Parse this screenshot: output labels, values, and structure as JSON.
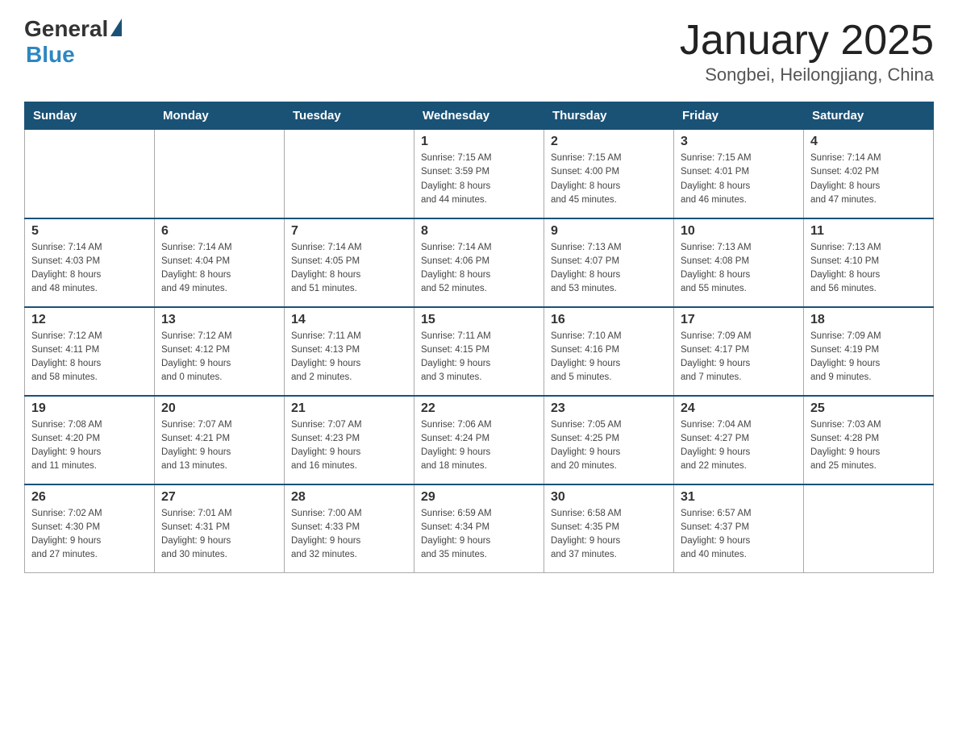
{
  "header": {
    "title": "January 2025",
    "subtitle": "Songbei, Heilongjiang, China",
    "logo_general": "General",
    "logo_blue": "Blue"
  },
  "weekdays": [
    "Sunday",
    "Monday",
    "Tuesday",
    "Wednesday",
    "Thursday",
    "Friday",
    "Saturday"
  ],
  "weeks": [
    [
      {
        "day": "",
        "info": ""
      },
      {
        "day": "",
        "info": ""
      },
      {
        "day": "",
        "info": ""
      },
      {
        "day": "1",
        "info": "Sunrise: 7:15 AM\nSunset: 3:59 PM\nDaylight: 8 hours\nand 44 minutes."
      },
      {
        "day": "2",
        "info": "Sunrise: 7:15 AM\nSunset: 4:00 PM\nDaylight: 8 hours\nand 45 minutes."
      },
      {
        "day": "3",
        "info": "Sunrise: 7:15 AM\nSunset: 4:01 PM\nDaylight: 8 hours\nand 46 minutes."
      },
      {
        "day": "4",
        "info": "Sunrise: 7:14 AM\nSunset: 4:02 PM\nDaylight: 8 hours\nand 47 minutes."
      }
    ],
    [
      {
        "day": "5",
        "info": "Sunrise: 7:14 AM\nSunset: 4:03 PM\nDaylight: 8 hours\nand 48 minutes."
      },
      {
        "day": "6",
        "info": "Sunrise: 7:14 AM\nSunset: 4:04 PM\nDaylight: 8 hours\nand 49 minutes."
      },
      {
        "day": "7",
        "info": "Sunrise: 7:14 AM\nSunset: 4:05 PM\nDaylight: 8 hours\nand 51 minutes."
      },
      {
        "day": "8",
        "info": "Sunrise: 7:14 AM\nSunset: 4:06 PM\nDaylight: 8 hours\nand 52 minutes."
      },
      {
        "day": "9",
        "info": "Sunrise: 7:13 AM\nSunset: 4:07 PM\nDaylight: 8 hours\nand 53 minutes."
      },
      {
        "day": "10",
        "info": "Sunrise: 7:13 AM\nSunset: 4:08 PM\nDaylight: 8 hours\nand 55 minutes."
      },
      {
        "day": "11",
        "info": "Sunrise: 7:13 AM\nSunset: 4:10 PM\nDaylight: 8 hours\nand 56 minutes."
      }
    ],
    [
      {
        "day": "12",
        "info": "Sunrise: 7:12 AM\nSunset: 4:11 PM\nDaylight: 8 hours\nand 58 minutes."
      },
      {
        "day": "13",
        "info": "Sunrise: 7:12 AM\nSunset: 4:12 PM\nDaylight: 9 hours\nand 0 minutes."
      },
      {
        "day": "14",
        "info": "Sunrise: 7:11 AM\nSunset: 4:13 PM\nDaylight: 9 hours\nand 2 minutes."
      },
      {
        "day": "15",
        "info": "Sunrise: 7:11 AM\nSunset: 4:15 PM\nDaylight: 9 hours\nand 3 minutes."
      },
      {
        "day": "16",
        "info": "Sunrise: 7:10 AM\nSunset: 4:16 PM\nDaylight: 9 hours\nand 5 minutes."
      },
      {
        "day": "17",
        "info": "Sunrise: 7:09 AM\nSunset: 4:17 PM\nDaylight: 9 hours\nand 7 minutes."
      },
      {
        "day": "18",
        "info": "Sunrise: 7:09 AM\nSunset: 4:19 PM\nDaylight: 9 hours\nand 9 minutes."
      }
    ],
    [
      {
        "day": "19",
        "info": "Sunrise: 7:08 AM\nSunset: 4:20 PM\nDaylight: 9 hours\nand 11 minutes."
      },
      {
        "day": "20",
        "info": "Sunrise: 7:07 AM\nSunset: 4:21 PM\nDaylight: 9 hours\nand 13 minutes."
      },
      {
        "day": "21",
        "info": "Sunrise: 7:07 AM\nSunset: 4:23 PM\nDaylight: 9 hours\nand 16 minutes."
      },
      {
        "day": "22",
        "info": "Sunrise: 7:06 AM\nSunset: 4:24 PM\nDaylight: 9 hours\nand 18 minutes."
      },
      {
        "day": "23",
        "info": "Sunrise: 7:05 AM\nSunset: 4:25 PM\nDaylight: 9 hours\nand 20 minutes."
      },
      {
        "day": "24",
        "info": "Sunrise: 7:04 AM\nSunset: 4:27 PM\nDaylight: 9 hours\nand 22 minutes."
      },
      {
        "day": "25",
        "info": "Sunrise: 7:03 AM\nSunset: 4:28 PM\nDaylight: 9 hours\nand 25 minutes."
      }
    ],
    [
      {
        "day": "26",
        "info": "Sunrise: 7:02 AM\nSunset: 4:30 PM\nDaylight: 9 hours\nand 27 minutes."
      },
      {
        "day": "27",
        "info": "Sunrise: 7:01 AM\nSunset: 4:31 PM\nDaylight: 9 hours\nand 30 minutes."
      },
      {
        "day": "28",
        "info": "Sunrise: 7:00 AM\nSunset: 4:33 PM\nDaylight: 9 hours\nand 32 minutes."
      },
      {
        "day": "29",
        "info": "Sunrise: 6:59 AM\nSunset: 4:34 PM\nDaylight: 9 hours\nand 35 minutes."
      },
      {
        "day": "30",
        "info": "Sunrise: 6:58 AM\nSunset: 4:35 PM\nDaylight: 9 hours\nand 37 minutes."
      },
      {
        "day": "31",
        "info": "Sunrise: 6:57 AM\nSunset: 4:37 PM\nDaylight: 9 hours\nand 40 minutes."
      },
      {
        "day": "",
        "info": ""
      }
    ]
  ]
}
